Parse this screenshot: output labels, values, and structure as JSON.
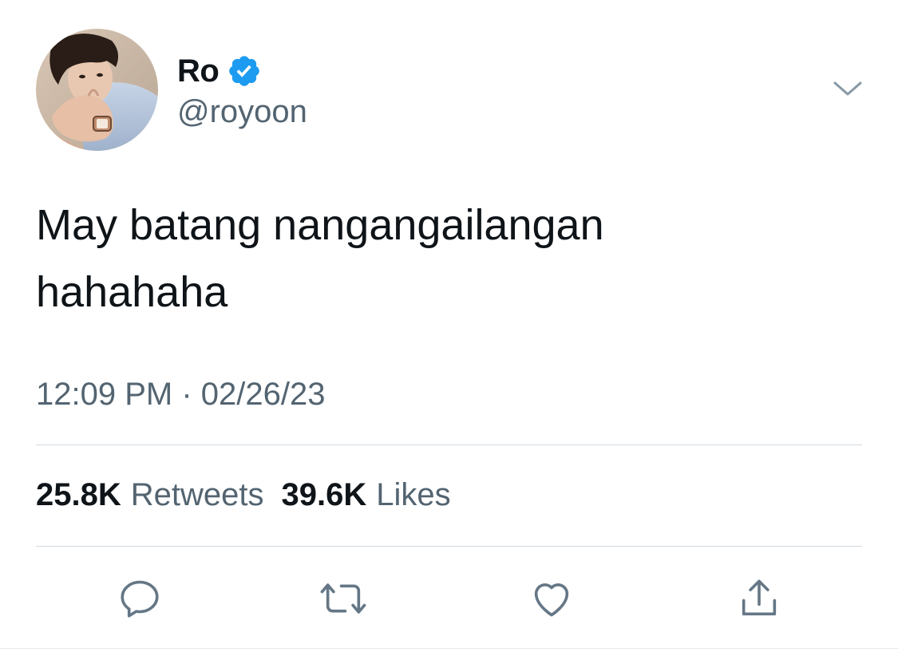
{
  "author": {
    "display_name": "Ro",
    "handle": "@royoon",
    "verified": true,
    "avatar_icon": "profile-photo"
  },
  "tweet": {
    "text_line1": "May batang nangangailangan",
    "text_line2": "hahahaha",
    "timestamp": "12:09 PM · 02/26/23"
  },
  "stats": {
    "retweets_count": "25.8K",
    "retweets_label": "Retweets",
    "likes_count": "39.6K",
    "likes_label": "Likes"
  },
  "actions": [
    {
      "name": "reply",
      "icon": "speech-bubble-icon"
    },
    {
      "name": "retweet",
      "icon": "retweet-arrows-icon"
    },
    {
      "name": "like",
      "icon": "heart-icon"
    },
    {
      "name": "share",
      "icon": "share-upload-icon"
    }
  ],
  "colors": {
    "text_primary": "#0f1419",
    "text_secondary": "#536471",
    "verified_blue": "#1d9bf0",
    "icon_gray": "#657786",
    "divider": "#cfd9de"
  }
}
